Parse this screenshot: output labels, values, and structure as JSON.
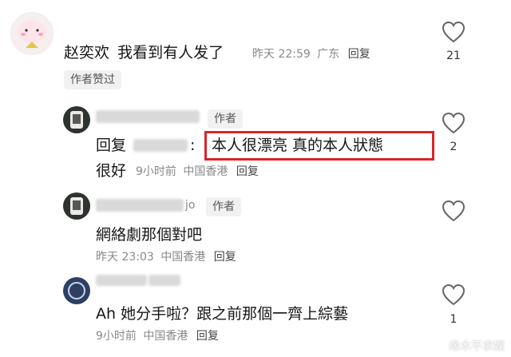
{
  "comment1": {
    "author": "赵奕欢",
    "text": "我看到有人发了",
    "time": "昨天 22:59",
    "location": "广东",
    "reply": "回复",
    "badge": "作者赞过",
    "likes": "21"
  },
  "comment2": {
    "author_tag": "作者",
    "reply_prefix": "回复",
    "colon": ":",
    "highlight": "本人很漂亮  真的本人狀態",
    "cont": "很好",
    "time": "9小时前",
    "location": "中国香港",
    "reply": "回复",
    "likes": "2"
  },
  "comment3": {
    "name_suffix": "jo",
    "author_tag": "作者",
    "text": "網絡劇那個對吧",
    "time": "昨天 23:03",
    "location": "中国香港",
    "reply": "回复"
  },
  "comment4": {
    "text": "Ah 她分手啦？跟之前那個一齊上綜藝",
    "time": "9小时前",
    "location": "中国香港",
    "reply": "回复",
    "likes": "1"
  },
  "watermark": "缘木不求娱",
  "colors": {
    "highlight_border": "#d9242a",
    "meta": "#888888",
    "tag_bg": "#f1f1f1"
  }
}
